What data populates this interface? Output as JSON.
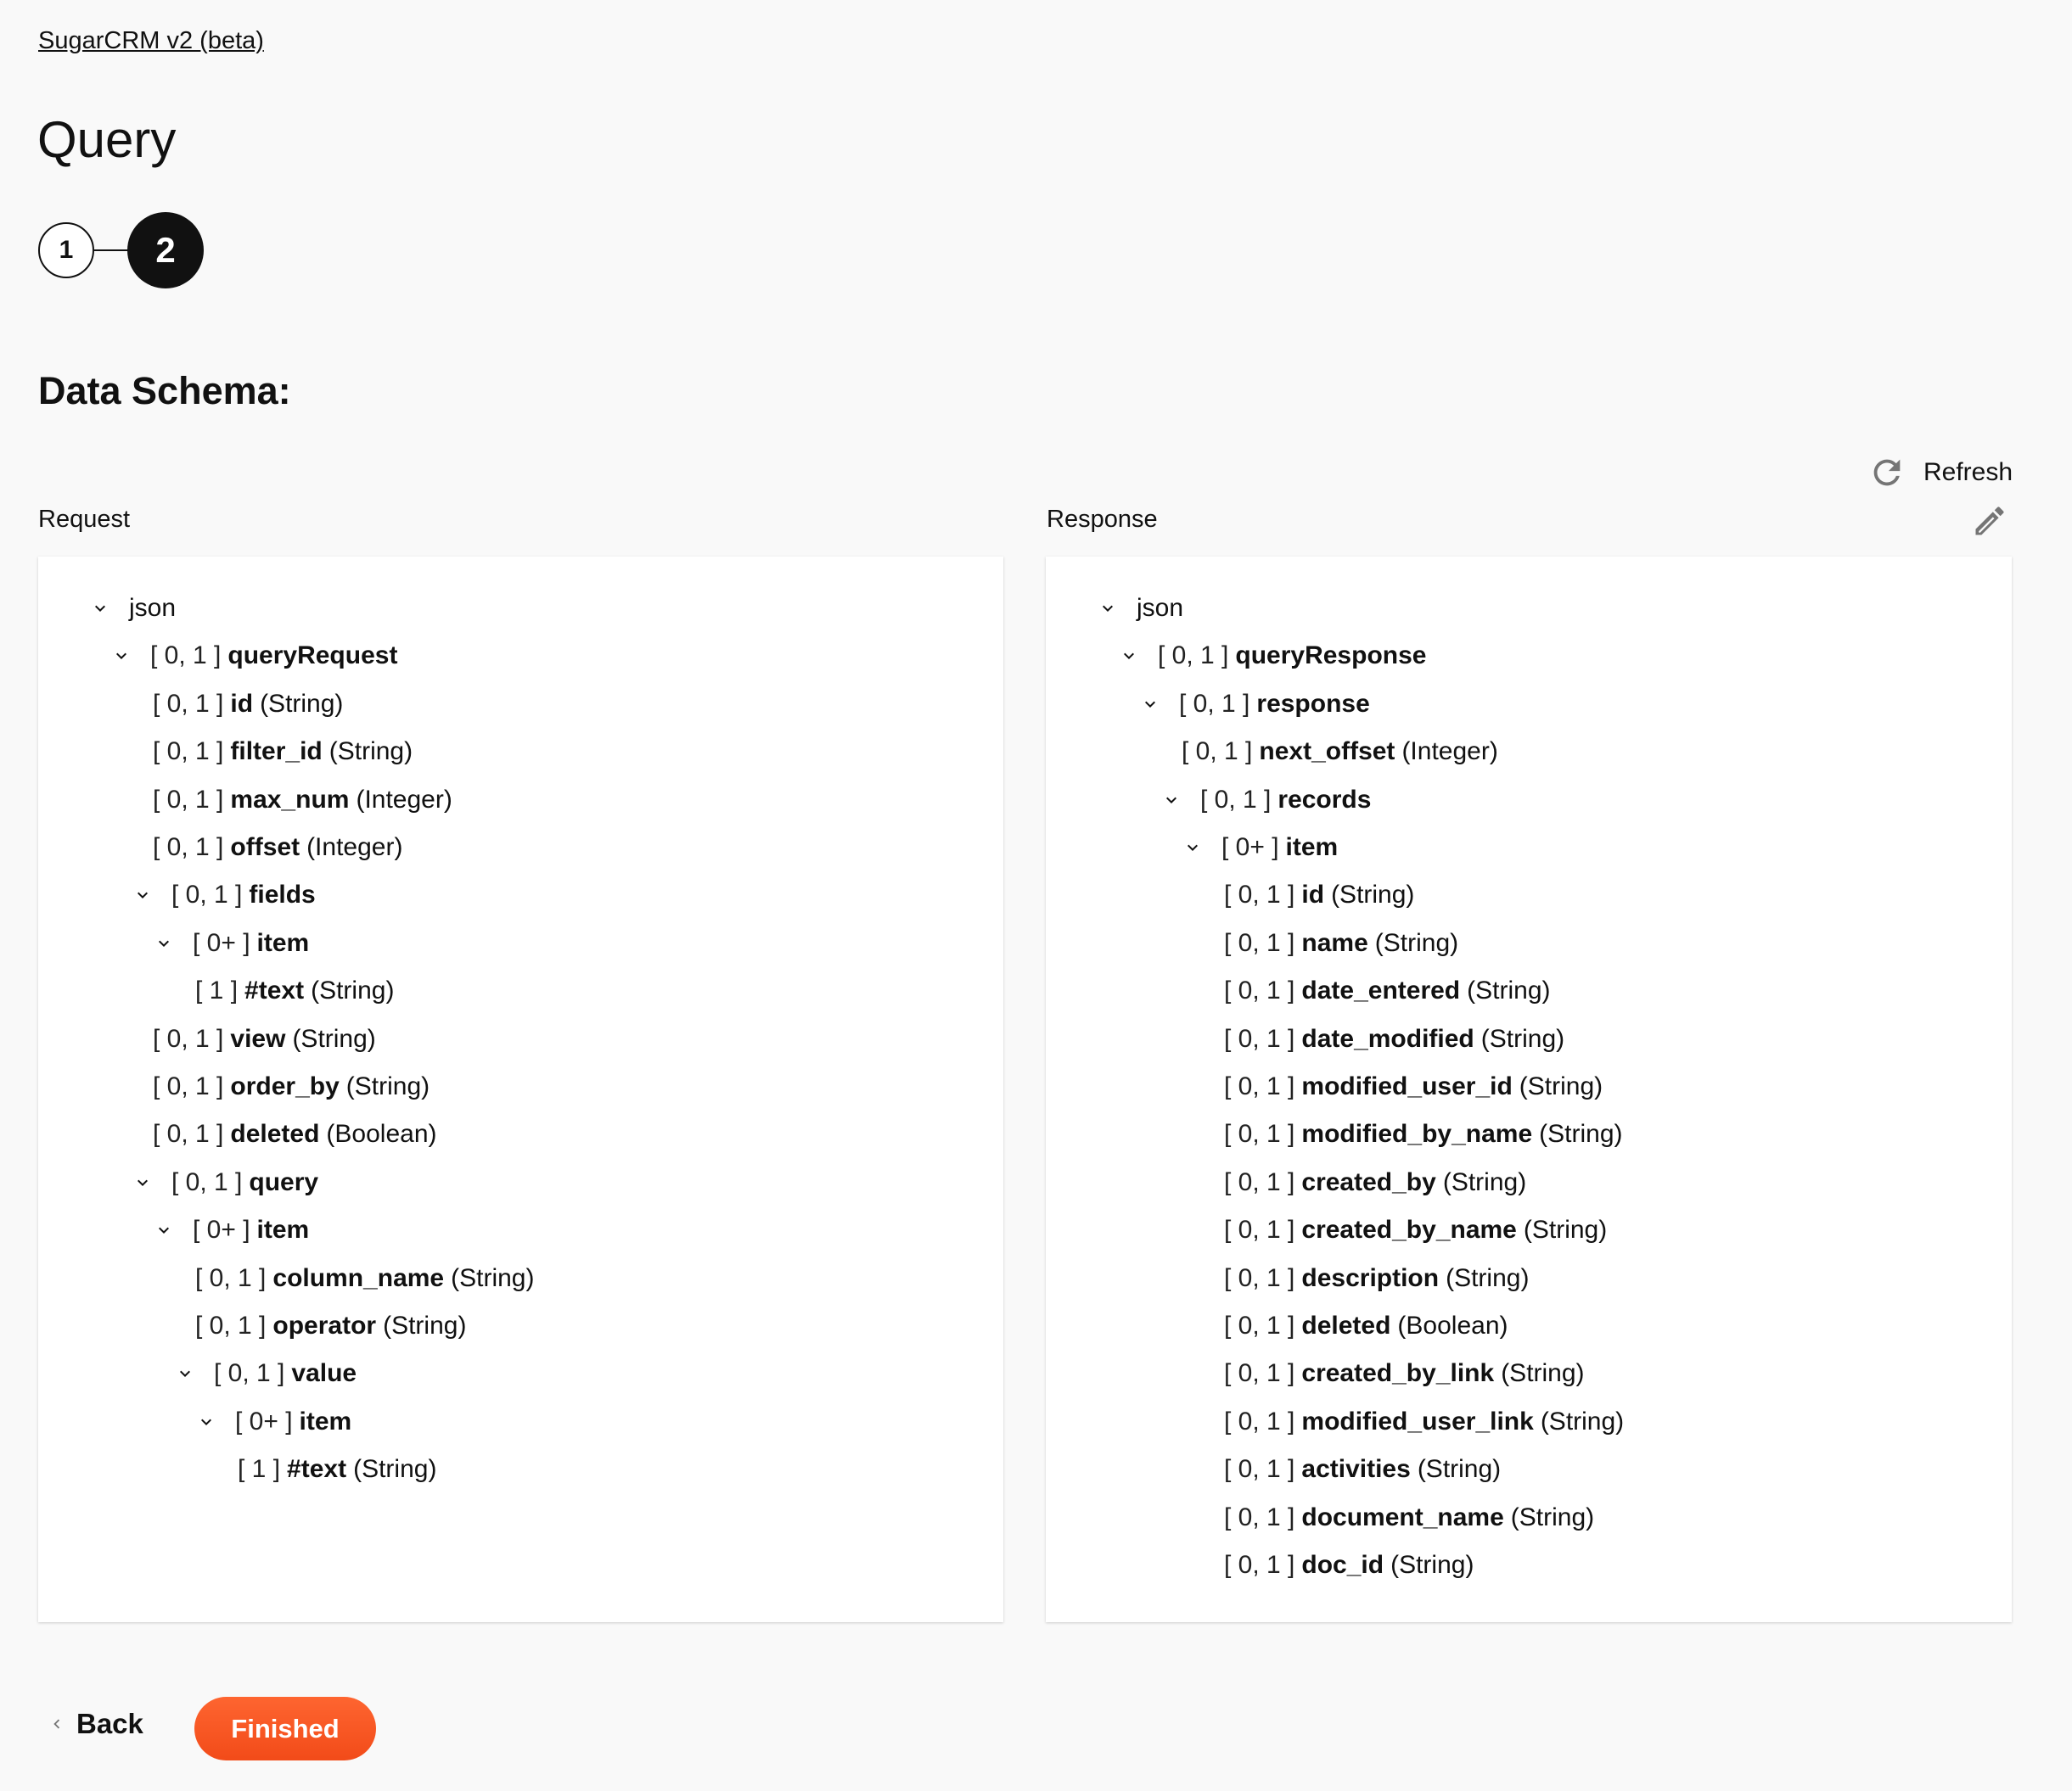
{
  "breadcrumb": {
    "label": "SugarCRM v2 (beta)"
  },
  "page_title": "Query",
  "stepper": {
    "steps": [
      "1",
      "2"
    ],
    "active": 2
  },
  "section_title": "Data Schema:",
  "toolbar": {
    "refresh_label": "Refresh",
    "refresh_icon": "refresh-icon",
    "edit_icon": "pencil-icon"
  },
  "request": {
    "label": "Request",
    "rows": [
      {
        "level": 0,
        "expandable": true,
        "card": "",
        "name": "json",
        "type": "",
        "plain": true
      },
      {
        "level": 1,
        "expandable": true,
        "card": "[ 0, 1 ]",
        "name": "queryRequest",
        "type": ""
      },
      {
        "level": 2,
        "expandable": false,
        "card": "[ 0, 1 ]",
        "name": "id",
        "type": "(String)"
      },
      {
        "level": 2,
        "expandable": false,
        "card": "[ 0, 1 ]",
        "name": "filter_id",
        "type": "(String)"
      },
      {
        "level": 2,
        "expandable": false,
        "card": "[ 0, 1 ]",
        "name": "max_num",
        "type": "(Integer)"
      },
      {
        "level": 2,
        "expandable": false,
        "card": "[ 0, 1 ]",
        "name": "offset",
        "type": "(Integer)"
      },
      {
        "level": 2,
        "expandable": true,
        "card": "[ 0, 1 ]",
        "name": "fields",
        "type": ""
      },
      {
        "level": 3,
        "expandable": true,
        "card": "[ 0+ ]",
        "name": "item",
        "type": ""
      },
      {
        "level": 4,
        "expandable": false,
        "card": "[ 1 ]",
        "name": "#text",
        "type": "(String)"
      },
      {
        "level": 2,
        "expandable": false,
        "card": "[ 0, 1 ]",
        "name": "view",
        "type": "(String)"
      },
      {
        "level": 2,
        "expandable": false,
        "card": "[ 0, 1 ]",
        "name": "order_by",
        "type": "(String)"
      },
      {
        "level": 2,
        "expandable": false,
        "card": "[ 0, 1 ]",
        "name": "deleted",
        "type": "(Boolean)"
      },
      {
        "level": 2,
        "expandable": true,
        "card": "[ 0, 1 ]",
        "name": "query",
        "type": ""
      },
      {
        "level": 3,
        "expandable": true,
        "card": "[ 0+ ]",
        "name": "item",
        "type": ""
      },
      {
        "level": 4,
        "expandable": false,
        "card": "[ 0, 1 ]",
        "name": "column_name",
        "type": "(String)"
      },
      {
        "level": 4,
        "expandable": false,
        "card": "[ 0, 1 ]",
        "name": "operator",
        "type": "(String)"
      },
      {
        "level": 4,
        "expandable": true,
        "card": "[ 0, 1 ]",
        "name": "value",
        "type": ""
      },
      {
        "level": 5,
        "expandable": true,
        "card": "[ 0+ ]",
        "name": "item",
        "type": ""
      },
      {
        "level": 6,
        "expandable": false,
        "card": "[ 1 ]",
        "name": "#text",
        "type": "(String)"
      }
    ]
  },
  "response": {
    "label": "Response",
    "rows": [
      {
        "level": 0,
        "expandable": true,
        "card": "",
        "name": "json",
        "type": "",
        "plain": true
      },
      {
        "level": 1,
        "expandable": true,
        "card": "[ 0, 1 ]",
        "name": "queryResponse",
        "type": ""
      },
      {
        "level": 2,
        "expandable": true,
        "card": "[ 0, 1 ]",
        "name": "response",
        "type": ""
      },
      {
        "level": 3,
        "expandable": false,
        "card": "[ 0, 1 ]",
        "name": "next_offset",
        "type": "(Integer)"
      },
      {
        "level": 3,
        "expandable": true,
        "card": "[ 0, 1 ]",
        "name": "records",
        "type": ""
      },
      {
        "level": 4,
        "expandable": true,
        "card": "[ 0+ ]",
        "name": "item",
        "type": ""
      },
      {
        "level": 5,
        "expandable": false,
        "card": "[ 0, 1 ]",
        "name": "id",
        "type": "(String)"
      },
      {
        "level": 5,
        "expandable": false,
        "card": "[ 0, 1 ]",
        "name": "name",
        "type": "(String)"
      },
      {
        "level": 5,
        "expandable": false,
        "card": "[ 0, 1 ]",
        "name": "date_entered",
        "type": "(String)"
      },
      {
        "level": 5,
        "expandable": false,
        "card": "[ 0, 1 ]",
        "name": "date_modified",
        "type": "(String)"
      },
      {
        "level": 5,
        "expandable": false,
        "card": "[ 0, 1 ]",
        "name": "modified_user_id",
        "type": "(String)"
      },
      {
        "level": 5,
        "expandable": false,
        "card": "[ 0, 1 ]",
        "name": "modified_by_name",
        "type": "(String)"
      },
      {
        "level": 5,
        "expandable": false,
        "card": "[ 0, 1 ]",
        "name": "created_by",
        "type": "(String)"
      },
      {
        "level": 5,
        "expandable": false,
        "card": "[ 0, 1 ]",
        "name": "created_by_name",
        "type": "(String)"
      },
      {
        "level": 5,
        "expandable": false,
        "card": "[ 0, 1 ]",
        "name": "description",
        "type": "(String)"
      },
      {
        "level": 5,
        "expandable": false,
        "card": "[ 0, 1 ]",
        "name": "deleted",
        "type": "(Boolean)"
      },
      {
        "level": 5,
        "expandable": false,
        "card": "[ 0, 1 ]",
        "name": "created_by_link",
        "type": "(String)"
      },
      {
        "level": 5,
        "expandable": false,
        "card": "[ 0, 1 ]",
        "name": "modified_user_link",
        "type": "(String)"
      },
      {
        "level": 5,
        "expandable": false,
        "card": "[ 0, 1 ]",
        "name": "activities",
        "type": "(String)"
      },
      {
        "level": 5,
        "expandable": false,
        "card": "[ 0, 1 ]",
        "name": "document_name",
        "type": "(String)"
      },
      {
        "level": 5,
        "expandable": false,
        "card": "[ 0, 1 ]",
        "name": "doc_id",
        "type": "(String)"
      }
    ]
  },
  "footer": {
    "back_label": "Back",
    "finished_label": "Finished"
  },
  "colors": {
    "accent": "#f4511e",
    "text": "#111111",
    "icon": "#757575",
    "background": "#f9f9f9",
    "panel": "#ffffff"
  }
}
